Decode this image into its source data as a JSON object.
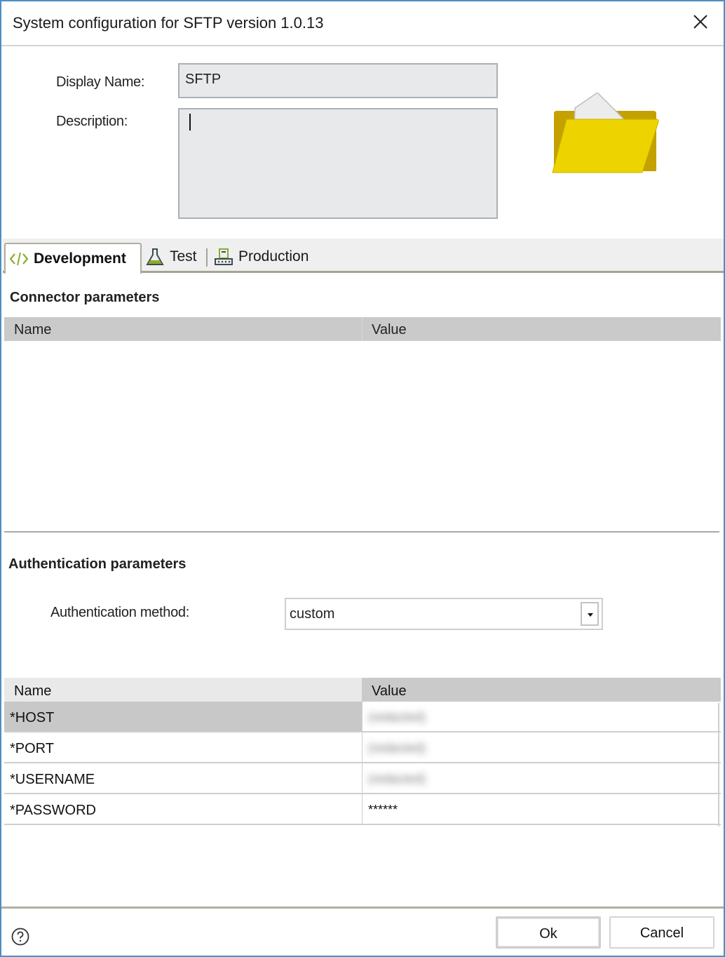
{
  "window": {
    "title": "System configuration for SFTP version 1.0.13",
    "close_icon": "close-icon"
  },
  "general": {
    "display_name_label": "Display Name:",
    "display_name_value": "SFTP",
    "description_label": "Description:",
    "description_value": "",
    "system_icon": "folder-icon"
  },
  "tabs": [
    {
      "label": "Development",
      "icon": "code-icon",
      "active": true
    },
    {
      "label": "Test",
      "icon": "flask-icon",
      "active": false
    },
    {
      "label": "Production",
      "icon": "server-icon",
      "active": false
    }
  ],
  "connector_parameters": {
    "title": "Connector parameters",
    "columns": [
      "Name",
      "Value"
    ],
    "rows": []
  },
  "authentication_parameters": {
    "title": "Authentication parameters",
    "method_label": "Authentication method:",
    "method_value": "custom",
    "columns": [
      "Name",
      "Value"
    ],
    "rows": [
      {
        "name": "*HOST",
        "value": "(redacted)",
        "blurred": true,
        "selected": true
      },
      {
        "name": "*PORT",
        "value": "(redacted)",
        "blurred": true,
        "selected": false
      },
      {
        "name": "*USERNAME",
        "value": "(redacted)",
        "blurred": true,
        "selected": false
      },
      {
        "name": "*PASSWORD",
        "value": "******",
        "blurred": false,
        "selected": false
      }
    ]
  },
  "footer": {
    "help_icon": "help-icon",
    "ok_label": "Ok",
    "cancel_label": "Cancel"
  },
  "colors": {
    "window_border": "#4a90c4",
    "header_gray": "#cacaca",
    "selected_row": "#c8c8c8",
    "folder_yellow": "#edd400",
    "tab_icon_green": "#8aad2c"
  }
}
